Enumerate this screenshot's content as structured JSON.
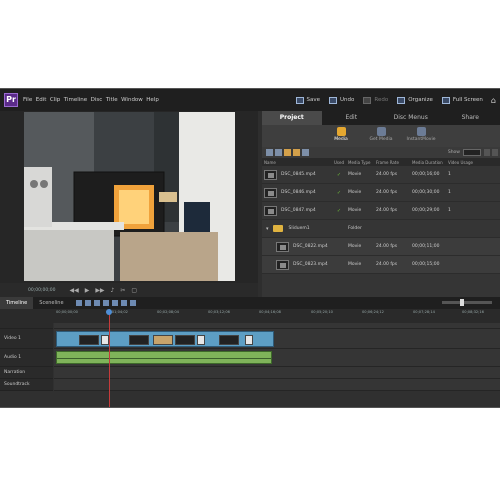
{
  "menubar": {
    "items": [
      "File",
      "Edit",
      "Clip",
      "Timeline",
      "Disc",
      "Title",
      "Window",
      "Help"
    ],
    "toolbar": {
      "save": "Save",
      "undo": "Undo",
      "redo": "Redo",
      "organize": "Organize",
      "fullscreen": "Full Screen"
    }
  },
  "monitor": {
    "timecode": "00;00;00;00"
  },
  "panel": {
    "tabs": [
      "Project",
      "Edit",
      "Disc Menus",
      "Share"
    ],
    "subtabs": [
      "Media",
      "Get Media",
      "InstantMovie"
    ],
    "show_label": "Show",
    "columns": [
      "Name",
      "Used",
      "Media Type",
      "Frame Rate",
      "Media Duration",
      "Video Usage"
    ],
    "rows": [
      {
        "name": "DSC_0845.mp4",
        "used": "✓",
        "type": "Movie",
        "rate": "24.00 fps",
        "dur": "00;00;16;00",
        "vu": "1"
      },
      {
        "name": "DSC_0846.mp4",
        "used": "✓",
        "type": "Movie",
        "rate": "24.00 fps",
        "dur": "00;00;30;00",
        "vu": "1"
      },
      {
        "name": "DSC_0847.mp4",
        "used": "✓",
        "type": "Movie",
        "rate": "24.00 fps",
        "dur": "00;00;29;00",
        "vu": "1"
      }
    ],
    "folder": {
      "name": "Sliduem1",
      "type": "Folder"
    },
    "subrows": [
      {
        "name": "DSC_0822.mp4",
        "type": "Movie",
        "rate": "24.00 fps",
        "dur": "00;00;11;00"
      },
      {
        "name": "DSC_0823.mp4",
        "type": "Movie",
        "rate": "24.00 fps",
        "dur": "00;00;15;00"
      }
    ]
  },
  "timeline": {
    "tabs": [
      "Timeline",
      "Sceneline"
    ],
    "ruler": [
      "00;00;00;00",
      "00;01;04;02",
      "00;02;08;04",
      "00;03;12;06",
      "00;04;16;08",
      "00;05;20;10",
      "00;06;24;12",
      "00;07;28;14",
      "00;08;32;16"
    ],
    "tracks": [
      "Video 1",
      "Audio 1",
      "Narration",
      "Soundtrack"
    ]
  }
}
